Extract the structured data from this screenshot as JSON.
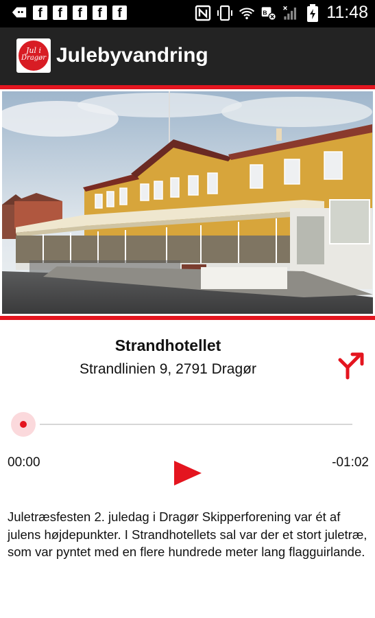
{
  "status_bar": {
    "time": "11:48",
    "notification_icons": [
      "back-arrow-icon",
      "facebook-icon",
      "facebook-icon",
      "facebook-icon",
      "facebook-icon",
      "facebook-icon"
    ],
    "system_icons": [
      "nfc-icon",
      "vibrate-icon",
      "wifi-icon",
      "data-saver-icon",
      "signal-icon",
      "battery-charging-icon"
    ]
  },
  "app_bar": {
    "title": "Julebyvandring",
    "logo_text_top": "Jul i",
    "logo_text_bottom": "Dragør"
  },
  "place": {
    "name": "Strandhotellet",
    "address": "Strandlinien 9, 2791 Dragør"
  },
  "player": {
    "elapsed": "00:00",
    "remaining": "-01:02",
    "progress": 0
  },
  "description": "Juletræsfesten 2. juledag i Dragør Skipperforening var ét af julens højdepunkter. I Strandhotellets sal var der et stort juletræ, som var pyntet med en flere hundrede meter lang flagguirlande.",
  "colors": {
    "accent": "#e4151f",
    "app_bar": "#232323",
    "status_bar": "#000000"
  }
}
